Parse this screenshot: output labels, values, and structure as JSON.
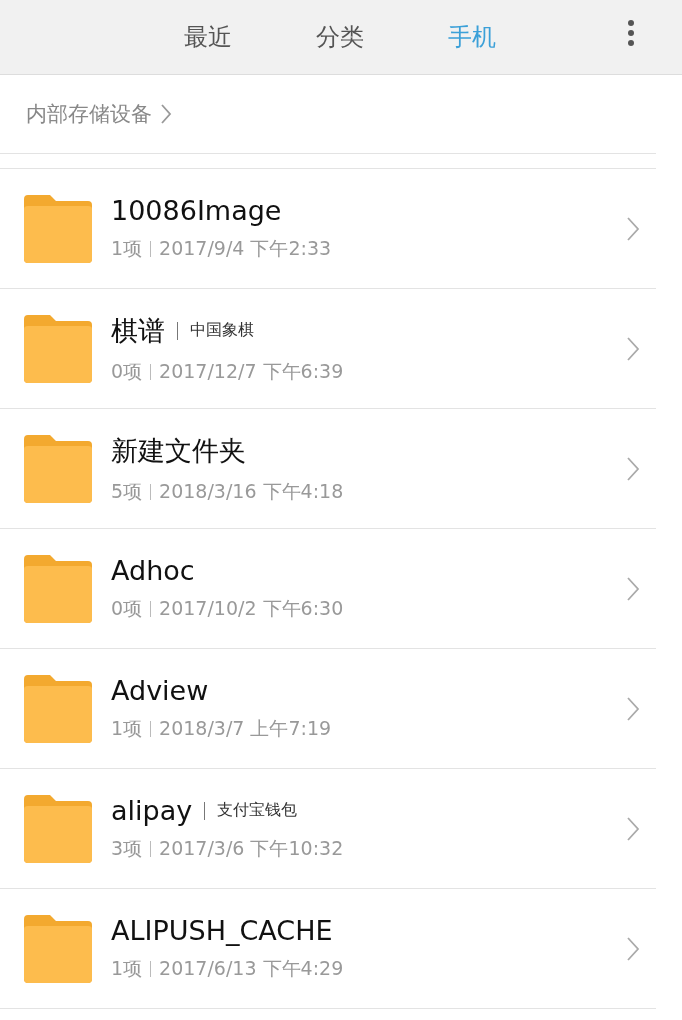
{
  "tabs": [
    {
      "label": "最近",
      "selected": false
    },
    {
      "label": "分类",
      "selected": false
    },
    {
      "label": "手机",
      "selected": true
    }
  ],
  "breadcrumb": {
    "label": "内部存储设备"
  },
  "folders": [
    {
      "name": "10086Image",
      "count": "1项",
      "date": "2017/9/4 下午2:33"
    },
    {
      "name": "棋谱",
      "tag": "中国象棋",
      "count": "0项",
      "date": "2017/12/7 下午6:39"
    },
    {
      "name": "新建文件夹",
      "count": "5项",
      "date": "2018/3/16 下午4:18"
    },
    {
      "name": "Adhoc",
      "count": "0项",
      "date": "2017/10/2 下午6:30"
    },
    {
      "name": "Adview",
      "count": "1项",
      "date": "2018/3/7 上午7:19"
    },
    {
      "name": "alipay",
      "tag": "支付宝钱包",
      "count": "3项",
      "date": "2017/3/6 下午10:32"
    },
    {
      "name": "ALIPUSH_CACHE",
      "count": "1项",
      "date": "2017/6/13 下午4:29"
    }
  ]
}
